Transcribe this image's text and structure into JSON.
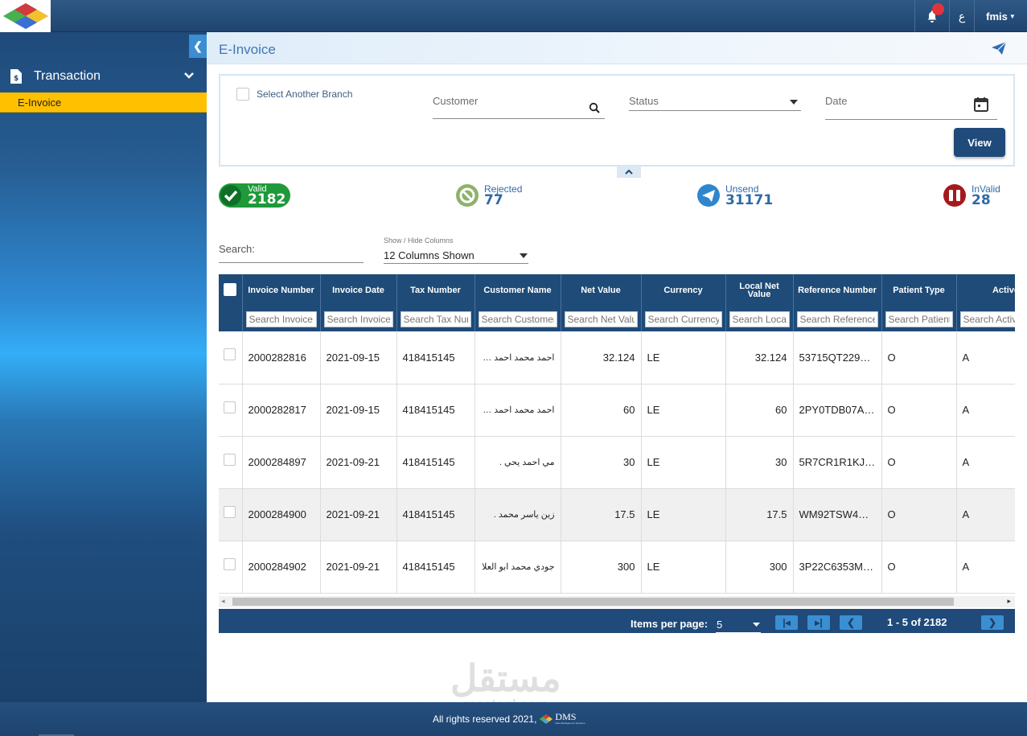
{
  "topbar": {
    "lang_toggle": "ع",
    "user": "fmis"
  },
  "sidebar": {
    "section": "Transaction",
    "active_item": "E-Invoice"
  },
  "page": {
    "title": "E-Invoice"
  },
  "filters": {
    "select_branch_label": "Select Another Branch",
    "customer_label": "Customer",
    "status_label": "Status",
    "date_label": "Date",
    "view_button": "View"
  },
  "stats": {
    "valid": {
      "label": "Valid",
      "count": "2182",
      "color": "#1e9a3a"
    },
    "rejected": {
      "label": "Rejected",
      "count": "77",
      "color": "#8db26a"
    },
    "unsend": {
      "label": "Unsend",
      "count": "31171",
      "color": "#2f86cf"
    },
    "invalid": {
      "label": "InValid",
      "count": "28",
      "color": "#a5191d"
    }
  },
  "table_controls": {
    "search_label": "Search:",
    "show_hide_label": "Show / Hide Columns",
    "columns_selected": "12 Columns Shown"
  },
  "table": {
    "columns": [
      "Invoice Number",
      "Invoice Date",
      "Tax Number",
      "Customer Name",
      "Net Value",
      "Currency",
      "Local Net Value",
      "Reference Number",
      "Patient Type",
      "Active"
    ],
    "filter_placeholders": [
      "Search Invoice Number",
      "Search Invoice Date",
      "Search Tax Number",
      "Search Customer Name",
      "Search Net Value",
      "Search Currency",
      "Search Local Net Value",
      "Search Reference Number",
      "Search Patient Type",
      "Search Active"
    ],
    "rows": [
      [
        "2000282816",
        "2021-09-15",
        "418415145",
        "احمد محمد احمد محمد",
        "32.124",
        "LE",
        "32.124",
        "53715QT229P…",
        "O",
        "A"
      ],
      [
        "2000282817",
        "2021-09-15",
        "418415145",
        "احمد محمد احمد محمد",
        "60",
        "LE",
        "60",
        "2PY0TDB07A4…",
        "O",
        "A"
      ],
      [
        "2000284897",
        "2021-09-21",
        "418415145",
        "مي احمد يحي .",
        "30",
        "LE",
        "30",
        "5R7CR1R1KJY…",
        "O",
        "A"
      ],
      [
        "2000284900",
        "2021-09-21",
        "418415145",
        "زين ياسر محمد .",
        "17.5",
        "LE",
        "17.5",
        "WM92TSW4H…",
        "O",
        "A"
      ],
      [
        "2000284902",
        "2021-09-21",
        "418415145",
        "جودي محمد ابو العلا",
        "300",
        "LE",
        "300",
        "3P22C6353M5…",
        "O",
        "A"
      ]
    ]
  },
  "pager": {
    "items_per_page_label": "Items per page:",
    "items_per_page": "5",
    "range": "1 - 5 of 2182"
  },
  "footer": {
    "copyright": "All rights reserved 2021,",
    "brand": "DMS",
    "brand_tagline": "Data Management Systems",
    "watermark": "مستقل",
    "watermark_latin": "mostaql.com"
  },
  "colors": {
    "primary": "#1f4a7a",
    "accent": "#ffc000",
    "link": "#3f76b4"
  }
}
